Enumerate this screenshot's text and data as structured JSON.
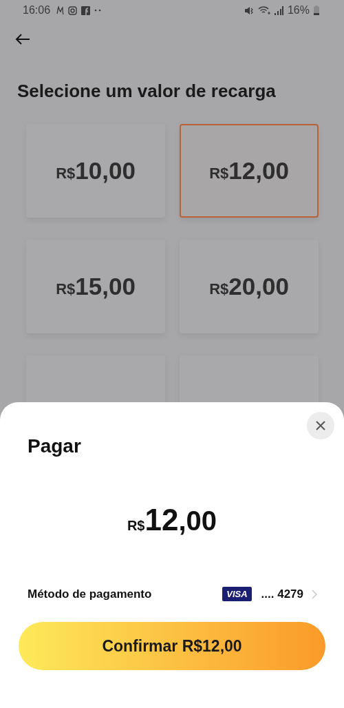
{
  "status_bar": {
    "time": "16:06",
    "battery": "16%"
  },
  "title": "Selecione um valor de recarga",
  "options": [
    {
      "currency": "R$",
      "amount": "10,00",
      "selected": false
    },
    {
      "currency": "R$",
      "amount": "12,00",
      "selected": true
    },
    {
      "currency": "R$",
      "amount": "15,00",
      "selected": false
    },
    {
      "currency": "R$",
      "amount": "20,00",
      "selected": false
    },
    {
      "selected": false
    },
    {
      "selected": false
    }
  ],
  "sheet": {
    "title": "Pagar",
    "currency": "R$",
    "amount": "12",
    "cents": ",00",
    "method_label": "Método de pagamento",
    "card_brand": "VISA",
    "card_number": ".... 4279",
    "confirm": "Confirmar R$12,00"
  }
}
